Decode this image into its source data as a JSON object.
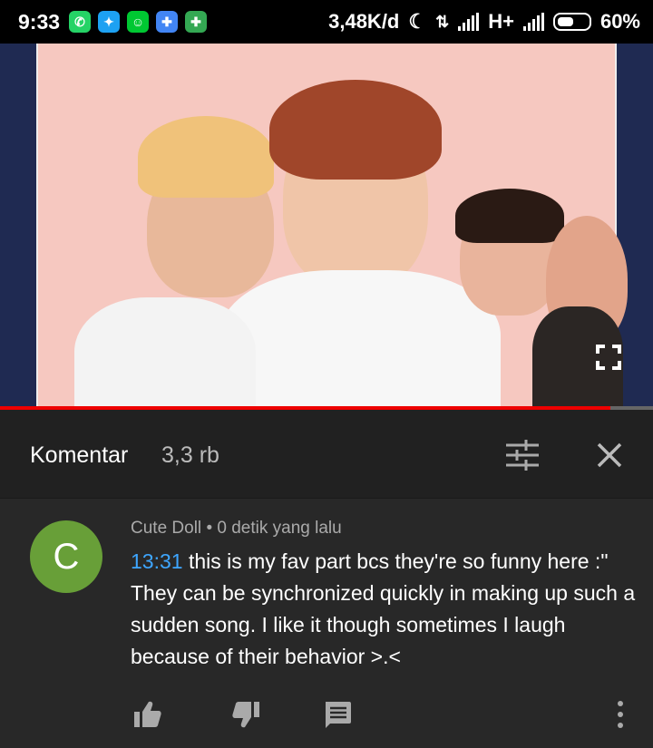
{
  "status_bar": {
    "time": "9:33",
    "apps": [
      "whatsapp-icon",
      "twitter-icon",
      "webtoon-icon",
      "play-games-icon",
      "play-games-icon"
    ],
    "network_speed": "3,48K/d",
    "network_type": "H+",
    "battery_percent": "60%",
    "battery_level": 0.6
  },
  "video": {
    "progress": 0.935,
    "fullscreen_icon": "fullscreen-icon"
  },
  "comments_header": {
    "title": "Komentar",
    "count": "3,3 rb"
  },
  "comment": {
    "avatar_letter": "C",
    "avatar_color": "#689f38",
    "author": "Cute Doll",
    "separator": "•",
    "time": "0 detik yang lalu",
    "timestamp_link": "13:31",
    "text": " this is my fav part bcs they're so funny here :\" They can be synchronized quickly in making up such a sudden song. I like it though sometimes I laugh because of their behavior >.<"
  },
  "colors": {
    "background": "#282828",
    "header_bg": "#212121",
    "link": "#3ea6ff",
    "progress": "#e00000"
  }
}
